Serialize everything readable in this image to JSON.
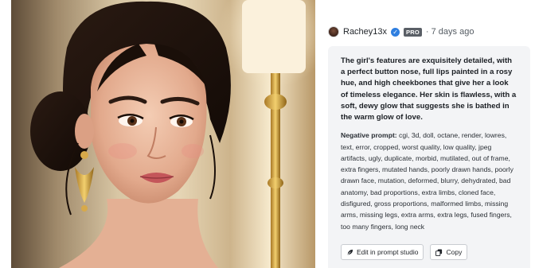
{
  "image": {
    "subject": "portrait-artwork"
  },
  "author": {
    "name": "Rachey13x",
    "badge": "PRO",
    "time_ago": "· 7 days ago"
  },
  "prompt": {
    "text": "The girl's features are exquisitely detailed, with a perfect button nose, full lips painted in a rosy hue, and high cheekbones that give her a look of timeless elegance. Her skin is flawless, with a soft, dewy glow that suggests she is bathed in the warm glow of love.",
    "negative_label": "Negative prompt:",
    "negative_text": " cgi, 3d, doll, octane, render, lowres, text, error, cropped, worst quality, low quality, jpeg artifacts, ugly, duplicate, morbid, mutilated, out of frame, extra fingers, mutated hands, poorly drawn hands, poorly drawn face, mutation, deformed, blurry, dehydrated, bad anatomy, bad proportions, extra limbs, cloned face, disfigured, gross proportions, malformed limbs, missing arms, missing legs, extra arms, extra legs, fused fingers, too many fingers, long neck"
  },
  "actions": {
    "edit_label": "Edit in prompt studio",
    "copy_label": "Copy"
  },
  "icons": {
    "verified": "verified-check-icon",
    "edit": "feather-pen-icon",
    "copy": "copy-icon"
  },
  "colors": {
    "verified_blue": "#2f7fe0",
    "card_bg": "#f3f4f6",
    "pro_badge_bg": "#5a5f66"
  }
}
